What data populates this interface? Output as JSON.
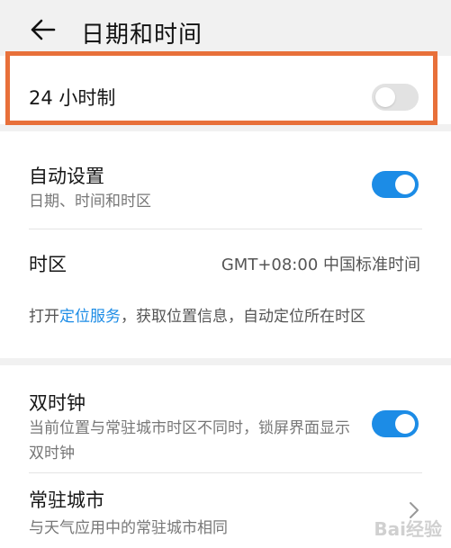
{
  "header": {
    "title": "日期和时间"
  },
  "hour24": {
    "label": "24 小时制",
    "toggle_on": false
  },
  "auto": {
    "label": "自动设置",
    "sub": "日期、时间和时区",
    "toggle_on": true
  },
  "timezone": {
    "label": "时区",
    "value": "GMT+08:00 中国标准时间"
  },
  "location_info": {
    "prefix": "打开",
    "link": "定位服务",
    "suffix": "，获取位置信息，自动定位所在时区"
  },
  "dual_clock": {
    "label": "双时钟",
    "sub": "当前位置与常驻城市时区不同时，锁屏界面显示双时钟",
    "toggle_on": true
  },
  "home_city": {
    "label": "常驻城市",
    "sub": "与天气应用中的常驻城市相同"
  },
  "watermark": "Bai经验",
  "colors": {
    "accent": "#1c8ce6",
    "highlight": "#e8703a"
  }
}
